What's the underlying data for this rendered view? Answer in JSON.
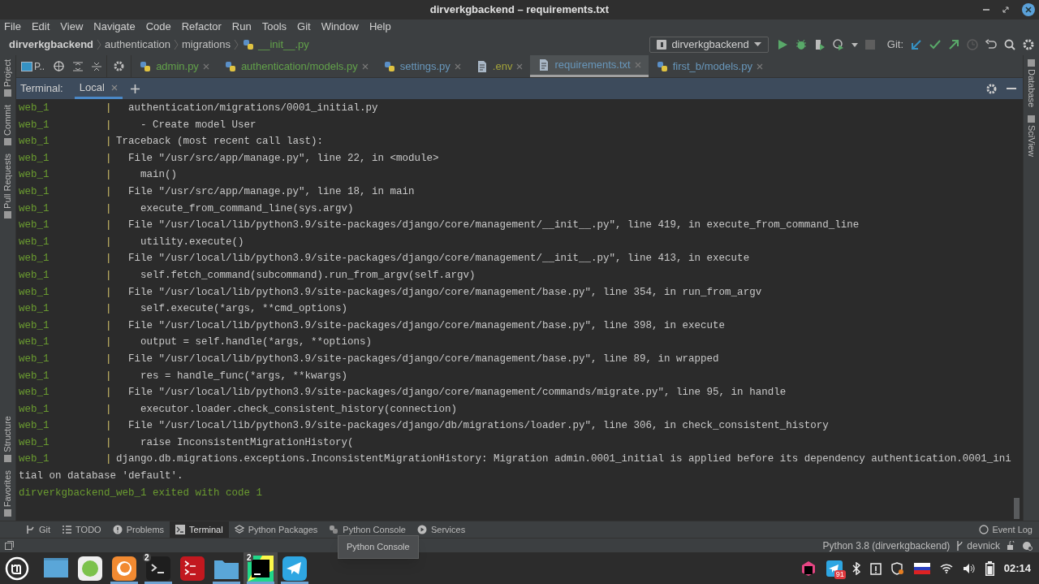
{
  "window": {
    "title": "dirverkgbackend – requirements.txt"
  },
  "menu": [
    "File",
    "Edit",
    "View",
    "Navigate",
    "Code",
    "Refactor",
    "Run",
    "Tools",
    "Git",
    "Window",
    "Help"
  ],
  "breadcrumb": [
    {
      "label": "dirverkgbackend",
      "kind": "project"
    },
    {
      "label": "authentication",
      "kind": "folder"
    },
    {
      "label": "migrations",
      "kind": "folder"
    },
    {
      "label": "__init__.py",
      "kind": "file"
    }
  ],
  "run_config": "dirverkgbackend",
  "git_label": "Git:",
  "project_dropdown": "P..",
  "left_tools": [
    "Project",
    "Commit",
    "Pull Requests",
    "Structure",
    "Favorites"
  ],
  "right_tools": [
    "Database",
    "SciView"
  ],
  "editor_tabs": [
    {
      "label": "admin.py",
      "kind": "python",
      "color": "#62a14a",
      "selected": false
    },
    {
      "label": "authentication/models.py",
      "kind": "python",
      "color": "#62a14a",
      "selected": false
    },
    {
      "label": "settings.py",
      "kind": "python",
      "color": "#6897bb",
      "selected": false
    },
    {
      "label": ".env",
      "kind": "text",
      "color": "#a3a33a",
      "selected": false
    },
    {
      "label": "requirements.txt",
      "kind": "text",
      "color": "#6897bb",
      "selected": true
    },
    {
      "label": "first_b/models.py",
      "kind": "python",
      "color": "#6897bb",
      "selected": false
    }
  ],
  "terminal": {
    "label": "Terminal:",
    "tabs": [
      {
        "label": "Local",
        "selected": true
      }
    ],
    "lines": [
      {
        "kind": "log",
        "prefix": "web_1",
        "separator": "|",
        "text": "  authentication/migrations/0001_initial.py"
      },
      {
        "kind": "log",
        "prefix": "web_1",
        "separator": "|",
        "text": "    - Create model User"
      },
      {
        "kind": "log",
        "prefix": "web_1",
        "separator": "|",
        "text": "Traceback (most recent call last):"
      },
      {
        "kind": "log",
        "prefix": "web_1",
        "separator": "|",
        "text": "  File \"/usr/src/app/manage.py\", line 22, in <module>"
      },
      {
        "kind": "log",
        "prefix": "web_1",
        "separator": "|",
        "text": "    main()"
      },
      {
        "kind": "log",
        "prefix": "web_1",
        "separator": "|",
        "text": "  File \"/usr/src/app/manage.py\", line 18, in main"
      },
      {
        "kind": "log",
        "prefix": "web_1",
        "separator": "|",
        "text": "    execute_from_command_line(sys.argv)"
      },
      {
        "kind": "log",
        "prefix": "web_1",
        "separator": "|",
        "text": "  File \"/usr/local/lib/python3.9/site-packages/django/core/management/__init__.py\", line 419, in execute_from_command_line"
      },
      {
        "kind": "log",
        "prefix": "web_1",
        "separator": "|",
        "text": "    utility.execute()"
      },
      {
        "kind": "log",
        "prefix": "web_1",
        "separator": "|",
        "text": "  File \"/usr/local/lib/python3.9/site-packages/django/core/management/__init__.py\", line 413, in execute"
      },
      {
        "kind": "log",
        "prefix": "web_1",
        "separator": "|",
        "text": "    self.fetch_command(subcommand).run_from_argv(self.argv)"
      },
      {
        "kind": "log",
        "prefix": "web_1",
        "separator": "|",
        "text": "  File \"/usr/local/lib/python3.9/site-packages/django/core/management/base.py\", line 354, in run_from_argv"
      },
      {
        "kind": "log",
        "prefix": "web_1",
        "separator": "|",
        "text": "    self.execute(*args, **cmd_options)"
      },
      {
        "kind": "log",
        "prefix": "web_1",
        "separator": "|",
        "text": "  File \"/usr/local/lib/python3.9/site-packages/django/core/management/base.py\", line 398, in execute"
      },
      {
        "kind": "log",
        "prefix": "web_1",
        "separator": "|",
        "text": "    output = self.handle(*args, **options)"
      },
      {
        "kind": "log",
        "prefix": "web_1",
        "separator": "|",
        "text": "  File \"/usr/local/lib/python3.9/site-packages/django/core/management/base.py\", line 89, in wrapped"
      },
      {
        "kind": "log",
        "prefix": "web_1",
        "separator": "|",
        "text": "    res = handle_func(*args, **kwargs)"
      },
      {
        "kind": "log",
        "prefix": "web_1",
        "separator": "|",
        "text": "  File \"/usr/local/lib/python3.9/site-packages/django/core/management/commands/migrate.py\", line 95, in handle"
      },
      {
        "kind": "log",
        "prefix": "web_1",
        "separator": "|",
        "text": "    executor.loader.check_consistent_history(connection)"
      },
      {
        "kind": "log",
        "prefix": "web_1",
        "separator": "|",
        "text": "  File \"/usr/local/lib/python3.9/site-packages/django/db/migrations/loader.py\", line 306, in check_consistent_history"
      },
      {
        "kind": "log",
        "prefix": "web_1",
        "separator": "|",
        "text": "    raise InconsistentMigrationHistory("
      },
      {
        "kind": "log",
        "prefix": "web_1",
        "separator": "|",
        "text": "django.db.migrations.exceptions.InconsistentMigrationHistory: Migration admin.0001_initial is applied before its dependency authentication.0001_ini"
      },
      {
        "kind": "plain",
        "text": "tial on database 'default'."
      },
      {
        "kind": "exit",
        "text": "dirverkgbackend_web_1 exited with code 1"
      }
    ]
  },
  "tool_windows": [
    {
      "label": "Git",
      "kind": "git",
      "selected": false
    },
    {
      "label": "TODO",
      "kind": "todo",
      "selected": false
    },
    {
      "label": "Problems",
      "kind": "problems",
      "selected": false
    },
    {
      "label": "Terminal",
      "kind": "terminal",
      "selected": true
    },
    {
      "label": "Python Packages",
      "kind": "packages",
      "selected": false
    },
    {
      "label": "Python Console",
      "kind": "console",
      "selected": false
    },
    {
      "label": "Services",
      "kind": "services",
      "selected": false
    }
  ],
  "event_log": "Event Log",
  "tooltip": "Python Console",
  "status_bar": {
    "interpreter": "Python 3.8 (dirverkgbackend)",
    "branch": "devnick"
  },
  "taskbar": {
    "apps": [
      {
        "kind": "files-window",
        "active": false
      },
      {
        "kind": "apps",
        "active": false
      },
      {
        "kind": "firefox",
        "active": true
      },
      {
        "kind": "terminal",
        "badge": "2",
        "active": true
      },
      {
        "kind": "red-terminal",
        "active": false
      },
      {
        "kind": "folder",
        "active": true
      },
      {
        "kind": "pycharm",
        "badge": "2",
        "active": true
      },
      {
        "kind": "telegram",
        "active": true
      }
    ],
    "telegram_count": "91",
    "clock": "02:14"
  }
}
